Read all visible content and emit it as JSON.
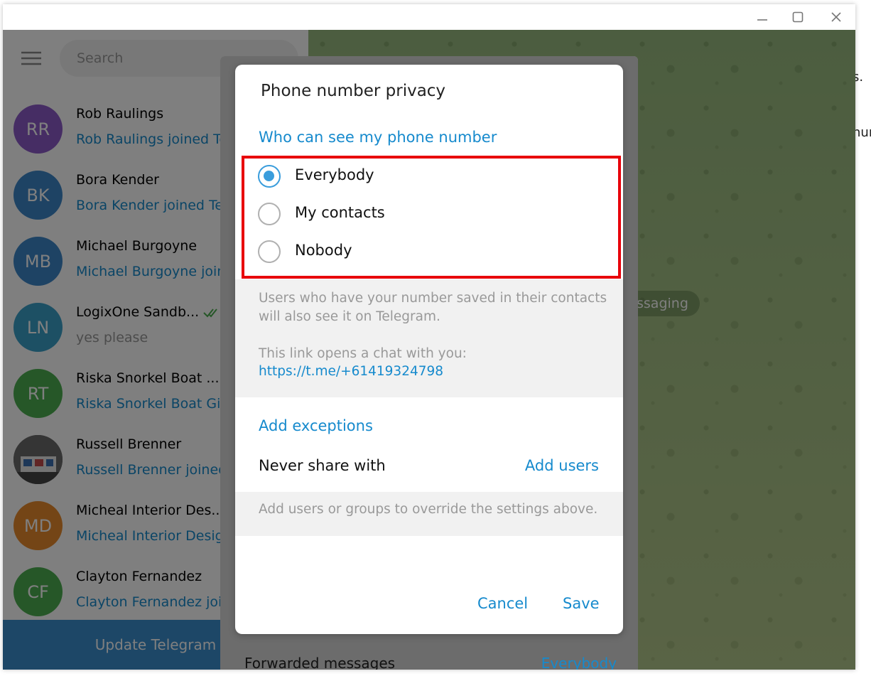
{
  "background_fragments": [
    "s.",
    "hur"
  ],
  "window": {
    "controls": [
      "minimize",
      "maximize",
      "close"
    ]
  },
  "left_pane": {
    "search_placeholder": "Search",
    "chats": [
      {
        "initials": "RR",
        "name": "Rob Raulings",
        "message": "Rob Raulings joined Te",
        "color": "#8d5bc9"
      },
      {
        "initials": "BK",
        "name": "Bora Kender",
        "message": "Bora Kender joined Tel",
        "color": "#3c86c9"
      },
      {
        "initials": "MB",
        "name": "Michael Burgoyne",
        "message": "Michael Burgoyne joine",
        "color": "#3c86c9"
      },
      {
        "initials": "LN",
        "name": "LogixOne Sandb...",
        "message": "yes please",
        "color": "#3aa0c9"
      },
      {
        "initials": "RT",
        "name": "Riska Snorkel Boat ...",
        "message": "Riska Snorkel Boat Gili",
        "color": "#4caf50"
      },
      {
        "initials": "",
        "name": "Russell Brenner",
        "message": "Russell Brenner joined",
        "color": "#555555"
      },
      {
        "initials": "MD",
        "name": "Micheal Interior Des...",
        "message": "Micheal Interior Design",
        "color": "#e88a2c"
      },
      {
        "initials": "CF",
        "name": "Clayton Fernandez",
        "message": "Clayton Fernandez join",
        "color": "#4caf50"
      }
    ],
    "update_button": "Update Telegram"
  },
  "chat_pane": {
    "pill_text": "ssaging"
  },
  "settings_panel": {
    "bottom_row_label": "Forwarded messages",
    "bottom_row_value": "Everybody"
  },
  "dialog": {
    "title": "Phone number privacy",
    "section_title": "Who can see my phone number",
    "options": [
      {
        "label": "Everybody",
        "selected": true
      },
      {
        "label": "My contacts",
        "selected": false
      },
      {
        "label": "Nobody",
        "selected": false
      }
    ],
    "info_line1": "Users who have your number saved in their contacts",
    "info_line2": "will also see it on Telegram.",
    "link_caption": "This link opens a chat with you:",
    "link_url": "https://t.me/+61419324798",
    "exceptions_title": "Add exceptions",
    "never_share_label": "Never share with",
    "add_users_label": "Add users",
    "exceptions_hint": "Add users or groups to override the settings above.",
    "cancel_label": "Cancel",
    "save_label": "Save"
  },
  "colors": {
    "accent": "#168acd",
    "radio_checked": "#3a9ddc",
    "highlight_border": "#e8000b"
  }
}
